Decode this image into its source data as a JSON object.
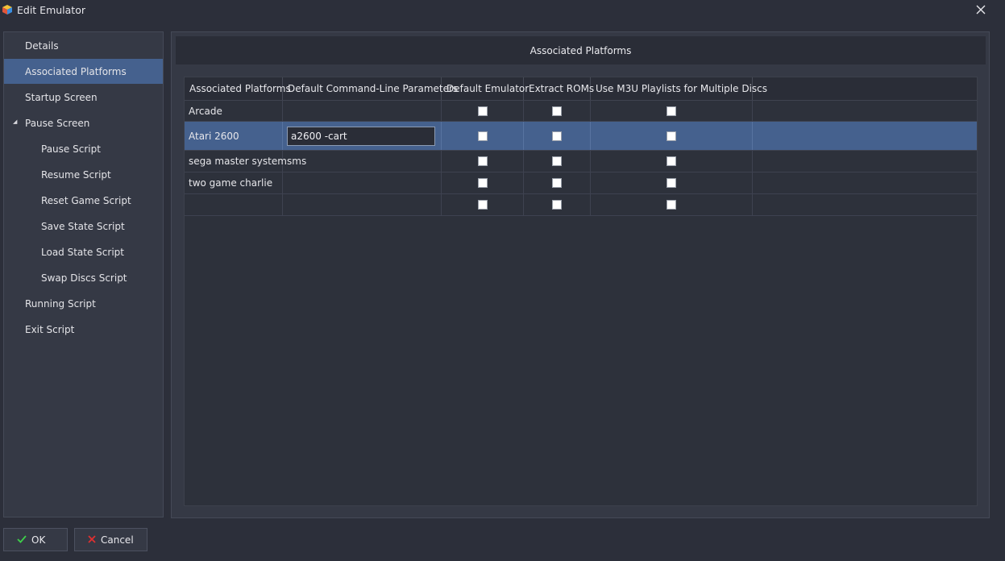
{
  "window": {
    "title": "Edit Emulator",
    "app_icon": "launchbox-cube-icon",
    "close_icon": "close-icon"
  },
  "sidebar": {
    "items": [
      {
        "label": "Details",
        "level": 0,
        "selected": false
      },
      {
        "label": "Associated Platforms",
        "level": 0,
        "selected": true
      },
      {
        "label": "Startup Screen",
        "level": 0,
        "selected": false
      },
      {
        "label": "Pause Screen",
        "level": 0,
        "selected": false,
        "expanded": true
      },
      {
        "label": "Pause Script",
        "level": 1,
        "selected": false
      },
      {
        "label": "Resume Script",
        "level": 1,
        "selected": false
      },
      {
        "label": "Reset Game Script",
        "level": 1,
        "selected": false
      },
      {
        "label": "Save State Script",
        "level": 1,
        "selected": false
      },
      {
        "label": "Load State Script",
        "level": 1,
        "selected": false
      },
      {
        "label": "Swap Discs Script",
        "level": 1,
        "selected": false
      },
      {
        "label": "Running Script",
        "level": 0,
        "selected": false
      },
      {
        "label": "Exit Script",
        "level": 0,
        "selected": false
      }
    ]
  },
  "panel": {
    "title": "Associated Platforms"
  },
  "table": {
    "columns": [
      "Associated Platforms",
      "Default Command-Line Parameters",
      "Default Emulator",
      "Extract ROMs",
      "Use M3U Playlists for Multiple Discs"
    ],
    "rows": [
      {
        "platform": "Arcade",
        "params": "",
        "default_emulator": false,
        "extract_roms": false,
        "use_m3u": false,
        "selected": false,
        "editing": false
      },
      {
        "platform": "Atari 2600",
        "params": "a2600 -cart",
        "default_emulator": false,
        "extract_roms": false,
        "use_m3u": false,
        "selected": true,
        "editing": true
      },
      {
        "platform": "sega master system",
        "params": "sms",
        "default_emulator": false,
        "extract_roms": false,
        "use_m3u": false,
        "selected": false,
        "editing": false
      },
      {
        "platform": "two game charlie",
        "params": "",
        "default_emulator": false,
        "extract_roms": false,
        "use_m3u": false,
        "selected": false,
        "editing": false
      },
      {
        "platform": "",
        "params": "",
        "default_emulator": false,
        "extract_roms": false,
        "use_m3u": false,
        "selected": false,
        "editing": false
      }
    ]
  },
  "buttons": {
    "ok_label": "OK",
    "ok_icon": "checkmark-icon",
    "ok_icon_color": "#3ecf4a",
    "cancel_label": "Cancel",
    "cancel_icon": "x-icon",
    "cancel_icon_color": "#e03030"
  },
  "colors": {
    "selection": "#45618e",
    "background": "#2c2f3a",
    "panel": "#353945"
  }
}
